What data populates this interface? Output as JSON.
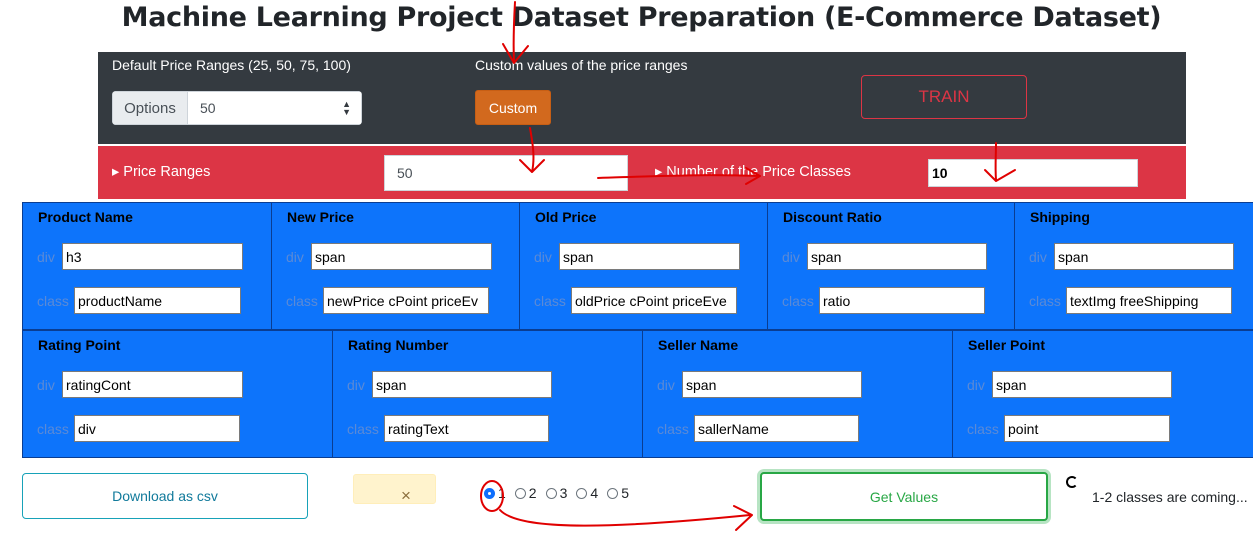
{
  "page": {
    "title": "Machine Learning Project Dataset Preparation (E-Commerce Dataset)"
  },
  "top_panel": {
    "default_ranges_label": "Default Price Ranges (25, 50, 75, 100)",
    "options_label": "Options",
    "selected_range": "50",
    "custom_label": "Custom values of the price ranges",
    "custom_button": "Custom",
    "train_button": "TRAIN"
  },
  "price_panel": {
    "price_ranges_label": "▸ Price Ranges",
    "price_ranges_value": "50",
    "num_classes_label": "▸ Number of the Price Classes",
    "num_classes_value": "10"
  },
  "field_labels": {
    "div": "div",
    "class": "class"
  },
  "fields_row1": [
    {
      "title": "Product Name",
      "div": "h3",
      "class": "productName"
    },
    {
      "title": "New Price",
      "div": "span",
      "class": "newPrice cPoint priceEv"
    },
    {
      "title": "Old Price",
      "div": "span",
      "class": "oldPrice cPoint priceEve"
    },
    {
      "title": "Discount Ratio",
      "div": "span",
      "class": "ratio"
    },
    {
      "title": "Shipping",
      "div": "span",
      "class": "textImg freeShipping"
    }
  ],
  "fields_row2": [
    {
      "title": "Rating Point",
      "div": "ratingCont",
      "class": "div"
    },
    {
      "title": "Rating Number",
      "div": "span",
      "class": "ratingText"
    },
    {
      "title": "Seller Name",
      "div": "span",
      "class": "sallerName"
    },
    {
      "title": "Seller Point",
      "div": "span",
      "class": "point"
    }
  ],
  "bottom": {
    "download_button": "Download as csv",
    "alert_close": "×",
    "radios": [
      "1",
      "2",
      "3",
      "4",
      "5"
    ],
    "selected_radio": "1",
    "get_values_button": "Get Values",
    "status_text": "1-2 classes are coming..."
  },
  "colors": {
    "dark_panel": "#343a40",
    "red_panel": "#dc3545",
    "blue_grid": "#0d74fb",
    "custom_button": "#d2691e",
    "annotation": "#e00000"
  }
}
